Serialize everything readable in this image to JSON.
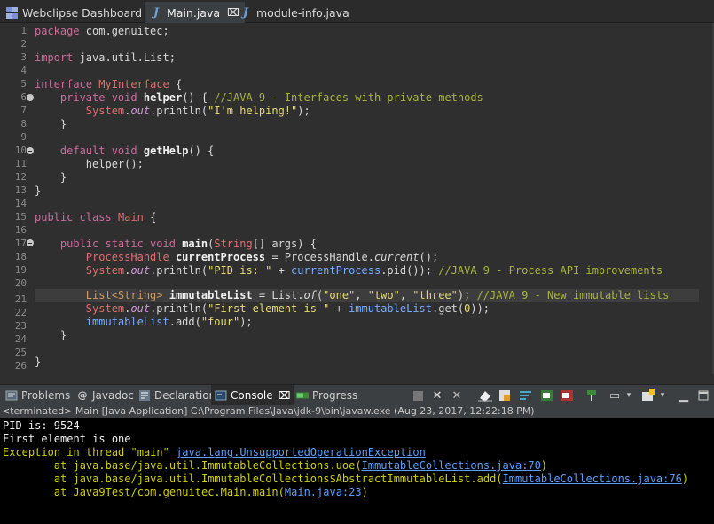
{
  "editor_tabs": [
    {
      "label": "Webclipse Dashboard",
      "icon": "dashboard-icon",
      "active": false
    },
    {
      "label": "Main.java",
      "icon": "java-file-icon",
      "active": true
    },
    {
      "label": "module-info.java",
      "icon": "java-file-icon",
      "active": false
    }
  ],
  "code": {
    "line_numbers": [
      "1",
      "2",
      "3",
      "4",
      "5",
      "6",
      "7",
      "8",
      "9",
      "10",
      "11",
      "12",
      "13",
      "14",
      "15",
      "16",
      "17",
      "18",
      "19",
      "20",
      "21",
      "22",
      "23",
      "24",
      "25",
      "26"
    ],
    "current_line": "21",
    "l1_kw": "package",
    "l1_rest": " com.genuitec;",
    "l3_kw": "import",
    "l3_rest": " java.util.List;",
    "l5_kw": "interface",
    "l5_name": "MyInterface",
    "l5_rest": " {",
    "l6_kw": "private void",
    "l6_name": "helper",
    "l6_rest": "() { ",
    "l6_cm": "//JAVA 9 - Interfaces with private methods",
    "l7_cls": "System",
    "l7_dot": ".",
    "l7_fld": "out",
    "l7_call": ".println(",
    "l7_str": "\"I'm helping!\"",
    "l7_end": ");",
    "l8": "}",
    "l10_kw": "default void",
    "l10_name": "getHelp",
    "l10_rest": "() {",
    "l11": "helper();",
    "l12": "}",
    "l13": "}",
    "l15_kw": "public class",
    "l15_name": "Main",
    "l15_rest": " {",
    "l17_kw": "public static void",
    "l17_name": "main",
    "l17_p1": "(",
    "l17_type": "String",
    "l17_p2": "[] args) {",
    "l18_cls": "ProcessHandle",
    "l18_var": "currentProcess",
    "l18_rest": " = ProcessHandle.",
    "l18_it": "current",
    "l18_end": "();",
    "l19_cls": "System",
    "l19_fld": "out",
    "l19_call": ".println(",
    "l19_str": "\"PID is: \"",
    "l19_plus": " + ",
    "l19_var": "currentProcess",
    "l19_rest": ".pid()); ",
    "l19_cm": "//JAVA 9 - Process API improvements",
    "l21_cls": "List<String>",
    "l21_var": "immutableList",
    "l21_rest": " = List.",
    "l21_it": "of",
    "l21_p": "(",
    "l21_s1": "\"one\"",
    "l21_c1": ", ",
    "l21_s2": "\"two\"",
    "l21_c2": ", ",
    "l21_s3": "\"three\"",
    "l21_end": "); ",
    "l21_cm": "//JAVA 9 - New immutable lists",
    "l22_cls": "System",
    "l22_fld": "out",
    "l22_call": ".println(",
    "l22_str": "\"First element is \"",
    "l22_plus": " + ",
    "l22_var": "immutableList",
    "l22_rest": ".get(",
    "l22_num": "0",
    "l22_end": "));",
    "l23_var": "immutableList",
    "l23_rest": ".add(",
    "l23_str": "\"four\"",
    "l23_end": ");",
    "l24": "}",
    "l26": "}"
  },
  "panel_tabs": [
    {
      "label": "Problems",
      "icon": "problems-icon"
    },
    {
      "label": "Javadoc",
      "icon": "javadoc-icon"
    },
    {
      "label": "Declaration",
      "icon": "declaration-icon"
    },
    {
      "label": "Console",
      "icon": "console-icon",
      "active": true
    },
    {
      "label": "Progress",
      "icon": "progress-icon"
    }
  ],
  "console": {
    "status": "<terminated> Main [Java Application] C:\\Program Files\\Java\\jdk-9\\bin\\javaw.exe (Aug 23, 2017, 12:22:18 PM)",
    "out1": "PID is: 9524",
    "out2": "First element is one",
    "exc_prefix": "Exception in thread \"main\" ",
    "exc_link": "java.lang.UnsupportedOperationException",
    "t1_prefix": "        at java.base/java.util.ImmutableCollections.uoe(",
    "t1_link": "ImmutableCollections.java:70",
    "t1_end": ")",
    "t2_prefix": "        at java.base/java.util.ImmutableCollections$AbstractImmutableList.add(",
    "t2_link": "ImmutableCollections.java:76",
    "t2_end": ")",
    "t3_prefix": "        at Java9Test/com.genuitec.Main.main(",
    "t3_link": "Main.java:23",
    "t3_end": ")"
  },
  "colors": {
    "keyword": "#cc6c9c",
    "class": "#cf9b60",
    "comment": "#a8b43c",
    "string": "#e6db74",
    "console_error": "#d0d000",
    "link": "#5aa0ff"
  }
}
